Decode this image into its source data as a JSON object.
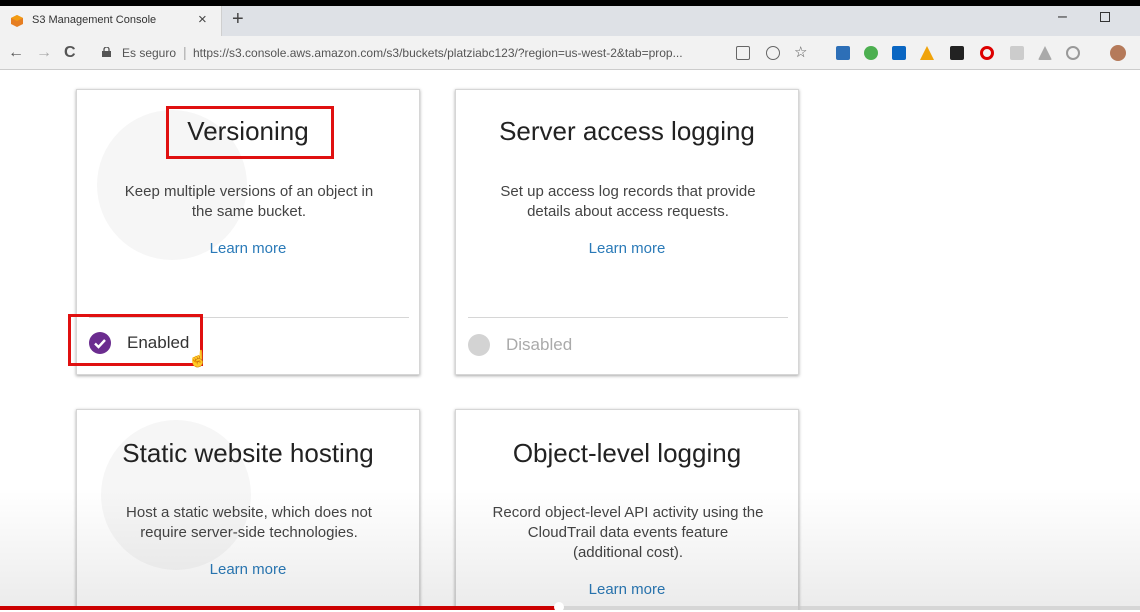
{
  "browser": {
    "tab_title": "S3 Management Console",
    "tab_close": "×",
    "new_tab": "+",
    "win_minimize": "–",
    "back": "←",
    "forward": "→",
    "reload": "C",
    "secure_label": "Es seguro",
    "separator": "|",
    "url": "https://s3.console.aws.amazon.com/s3/buckets/platziabc123/?region=us-west-2&tab=prop...",
    "extensions": [
      "translate-icon",
      "zoom-icon",
      "bookmark-star-icon",
      "ext-blue-icon",
      "ext-green-icon",
      "linkedin-icon",
      "ext-orange-icon",
      "amazon-icon",
      "opera-icon",
      "ext-grey-icon",
      "drive-icon",
      "ext-circle-icon",
      "avatar-icon"
    ]
  },
  "cards": [
    {
      "title": "Versioning",
      "desc_line1": "Keep multiple versions of an object in",
      "desc_line2": "the same bucket.",
      "link": "Learn more",
      "status": "Enabled"
    },
    {
      "title": "Server access logging",
      "desc_line1": "Set up access log records that provide",
      "desc_line2": "details about access requests.",
      "link": "Learn more",
      "status": "Disabled"
    },
    {
      "title": "Static website hosting",
      "desc_line1": "Host a static website, which does not",
      "desc_line2": "require server-side technologies.",
      "link": "Learn more"
    },
    {
      "title": "Object-level logging",
      "desc_line1": "Record object-level API activity using the",
      "desc_line2": "CloudTrail data events feature",
      "desc_line3": "(additional cost).",
      "link": "Learn more"
    }
  ],
  "colors": {
    "enabled": "#6b2c8f",
    "disabled": "#d3d3d3",
    "link": "#2a7ab8",
    "highlight": "#e01010",
    "video_progress": "#cc0000"
  },
  "video_progress_fraction": 0.49
}
